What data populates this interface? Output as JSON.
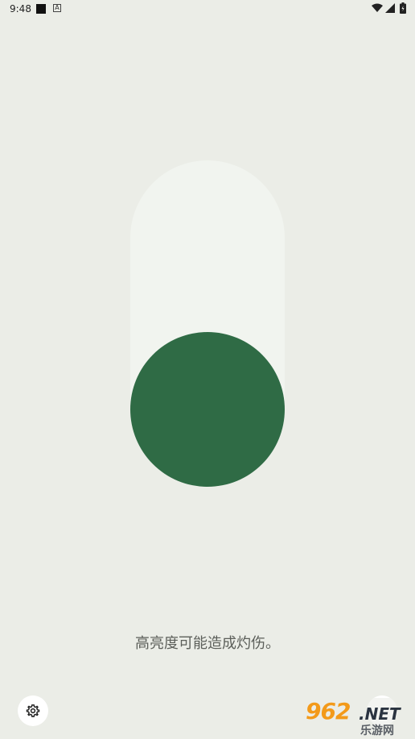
{
  "status_bar": {
    "time": "9:48",
    "notif_a": "A",
    "wifi_icon": "wifi-icon",
    "signal_icon": "signal-icon",
    "battery_icon": "battery-icon"
  },
  "switch": {
    "state": "off",
    "track_color": "#f1f4ef",
    "knob_color": "#2f6b45"
  },
  "warning": {
    "text": "高亮度可能造成灼伤。"
  },
  "settings_button": {
    "icon": "gear-icon"
  },
  "watermark": {
    "main": "962",
    "net": ".NET",
    "sub": "乐游网"
  },
  "colors": {
    "background": "#ebede7",
    "accent": "#2f6b45"
  }
}
